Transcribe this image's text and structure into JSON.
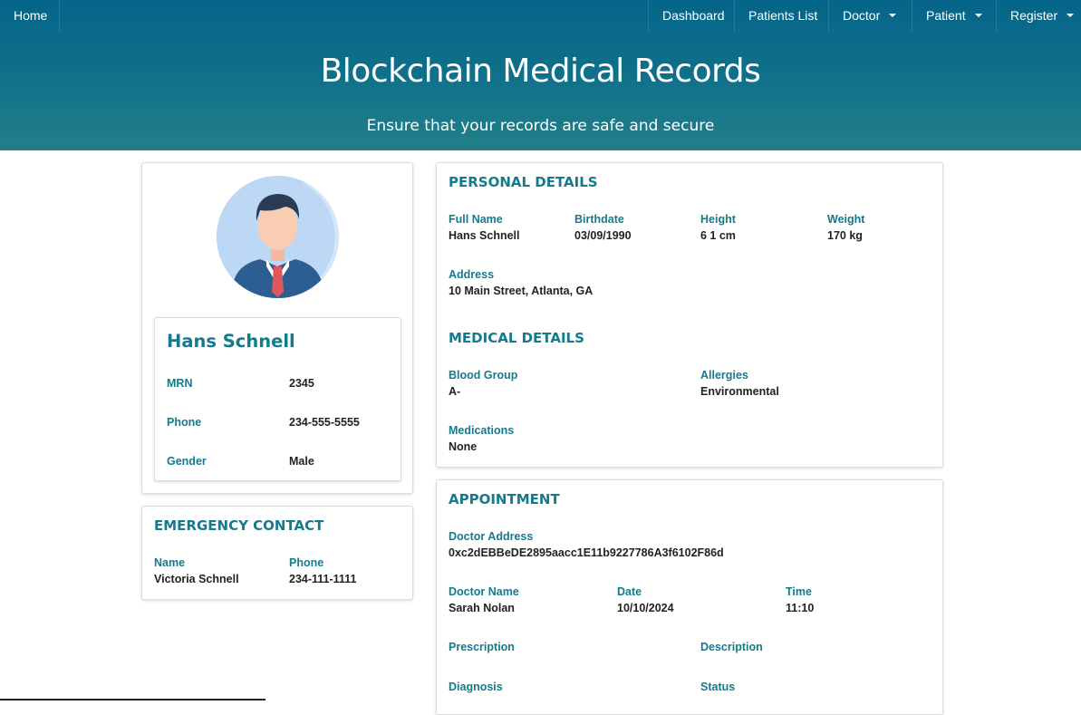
{
  "nav": {
    "home": "Home",
    "dashboard": "Dashboard",
    "patients_list": "Patients List",
    "doctor": "Doctor",
    "patient": "Patient",
    "register": "Register"
  },
  "hero": {
    "title": "Blockchain Medical Records",
    "subtitle": "Ensure that your records are safe and secure"
  },
  "profile": {
    "name": "Hans Schnell",
    "mrn_label": "MRN",
    "mrn": "2345",
    "phone_label": "Phone",
    "phone": "234-555-5555",
    "gender_label": "Gender",
    "gender": "Male"
  },
  "emergency": {
    "heading": "EMERGENCY CONTACT",
    "name_label": "Name",
    "name": "Victoria Schnell",
    "phone_label": "Phone",
    "phone": "234-111-1111"
  },
  "personal": {
    "heading": "PERSONAL DETAILS",
    "full_name_label": "Full Name",
    "full_name": "Hans Schnell",
    "birthdate_label": "Birthdate",
    "birthdate": "03/09/1990",
    "height_label": "Height",
    "height": "6 1 cm",
    "weight_label": "Weight",
    "weight": "170 kg",
    "address_label": "Address",
    "address": "10 Main Street, Atlanta, GA"
  },
  "medical": {
    "heading": "MEDICAL DETAILS",
    "blood_label": "Blood Group",
    "blood": "A-",
    "allergies_label": "Allergies",
    "allergies": "Environmental",
    "medications_label": "Medications",
    "medications": "None"
  },
  "appointment": {
    "heading": "APPOINTMENT",
    "doctor_address_label": "Doctor Address",
    "doctor_address": "0xc2dEBBeDE2895aacc1E11b9227786A3f6102F86d",
    "doctor_name_label": "Doctor Name",
    "doctor_name": "Sarah Nolan",
    "date_label": "Date",
    "date": "10/10/2024",
    "time_label": "Time",
    "time": "11:10",
    "prescription_label": "Prescription",
    "description_label": "Description",
    "diagnosis_label": "Diagnosis",
    "status_label": "Status"
  },
  "colors": {
    "accent": "#157a8c",
    "header_top": "#05658a",
    "header_bottom": "#227f88"
  },
  "icons": {
    "avatar": "businessman-avatar-icon"
  }
}
